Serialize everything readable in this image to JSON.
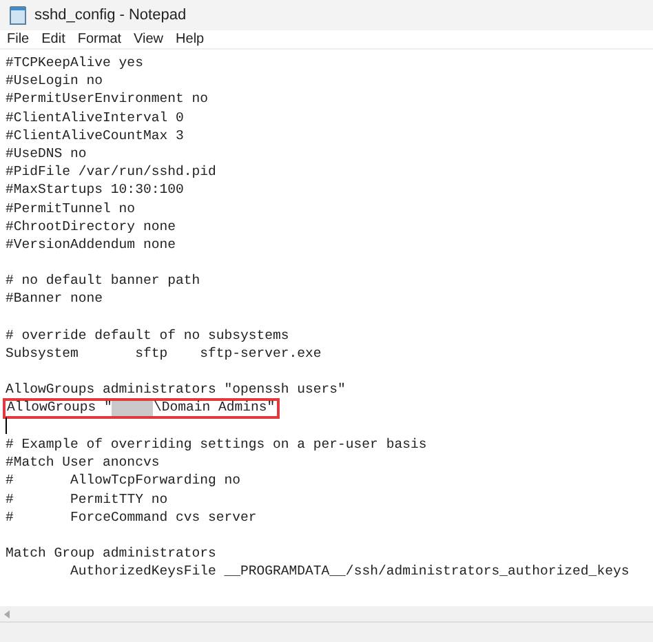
{
  "window": {
    "title": "sshd_config - Notepad"
  },
  "menu": [
    "File",
    "Edit",
    "Format",
    "View",
    "Help"
  ],
  "editor": {
    "lines": [
      {
        "kind": "text",
        "text": "#TCPKeepAlive yes"
      },
      {
        "kind": "text",
        "text": "#UseLogin no"
      },
      {
        "kind": "text",
        "text": "#PermitUserEnvironment no"
      },
      {
        "kind": "text",
        "text": "#ClientAliveInterval 0"
      },
      {
        "kind": "text",
        "text": "#ClientAliveCountMax 3"
      },
      {
        "kind": "text",
        "text": "#UseDNS no"
      },
      {
        "kind": "text",
        "text": "#PidFile /var/run/sshd.pid"
      },
      {
        "kind": "text",
        "text": "#MaxStartups 10:30:100"
      },
      {
        "kind": "text",
        "text": "#PermitTunnel no"
      },
      {
        "kind": "text",
        "text": "#ChrootDirectory none"
      },
      {
        "kind": "text",
        "text": "#VersionAddendum none"
      },
      {
        "kind": "blank"
      },
      {
        "kind": "text",
        "text": "# no default banner path"
      },
      {
        "kind": "text",
        "text": "#Banner none"
      },
      {
        "kind": "blank"
      },
      {
        "kind": "text",
        "text": "# override default of no subsystems"
      },
      {
        "kind": "text",
        "text": "Subsystem\tsftp\tsftp-server.exe"
      },
      {
        "kind": "blank"
      },
      {
        "kind": "text",
        "text": "AllowGroups administrators \"openssh users\""
      },
      {
        "kind": "highlighted",
        "before": "AllowGroups \"",
        "after": "\\Domain Admins\""
      },
      {
        "kind": "cursor"
      },
      {
        "kind": "text",
        "text": "# Example of overriding settings on a per-user basis"
      },
      {
        "kind": "text",
        "text": "#Match User anoncvs"
      },
      {
        "kind": "text",
        "text": "#\tAllowTcpForwarding no"
      },
      {
        "kind": "text",
        "text": "#\tPermitTTY no"
      },
      {
        "kind": "text",
        "text": "#\tForceCommand cvs server"
      },
      {
        "kind": "blank"
      },
      {
        "kind": "text",
        "text": "Match Group administrators"
      },
      {
        "kind": "text",
        "text": "\tAuthorizedKeysFile __PROGRAMDATA__/ssh/administrators_authorized_keys"
      }
    ]
  }
}
